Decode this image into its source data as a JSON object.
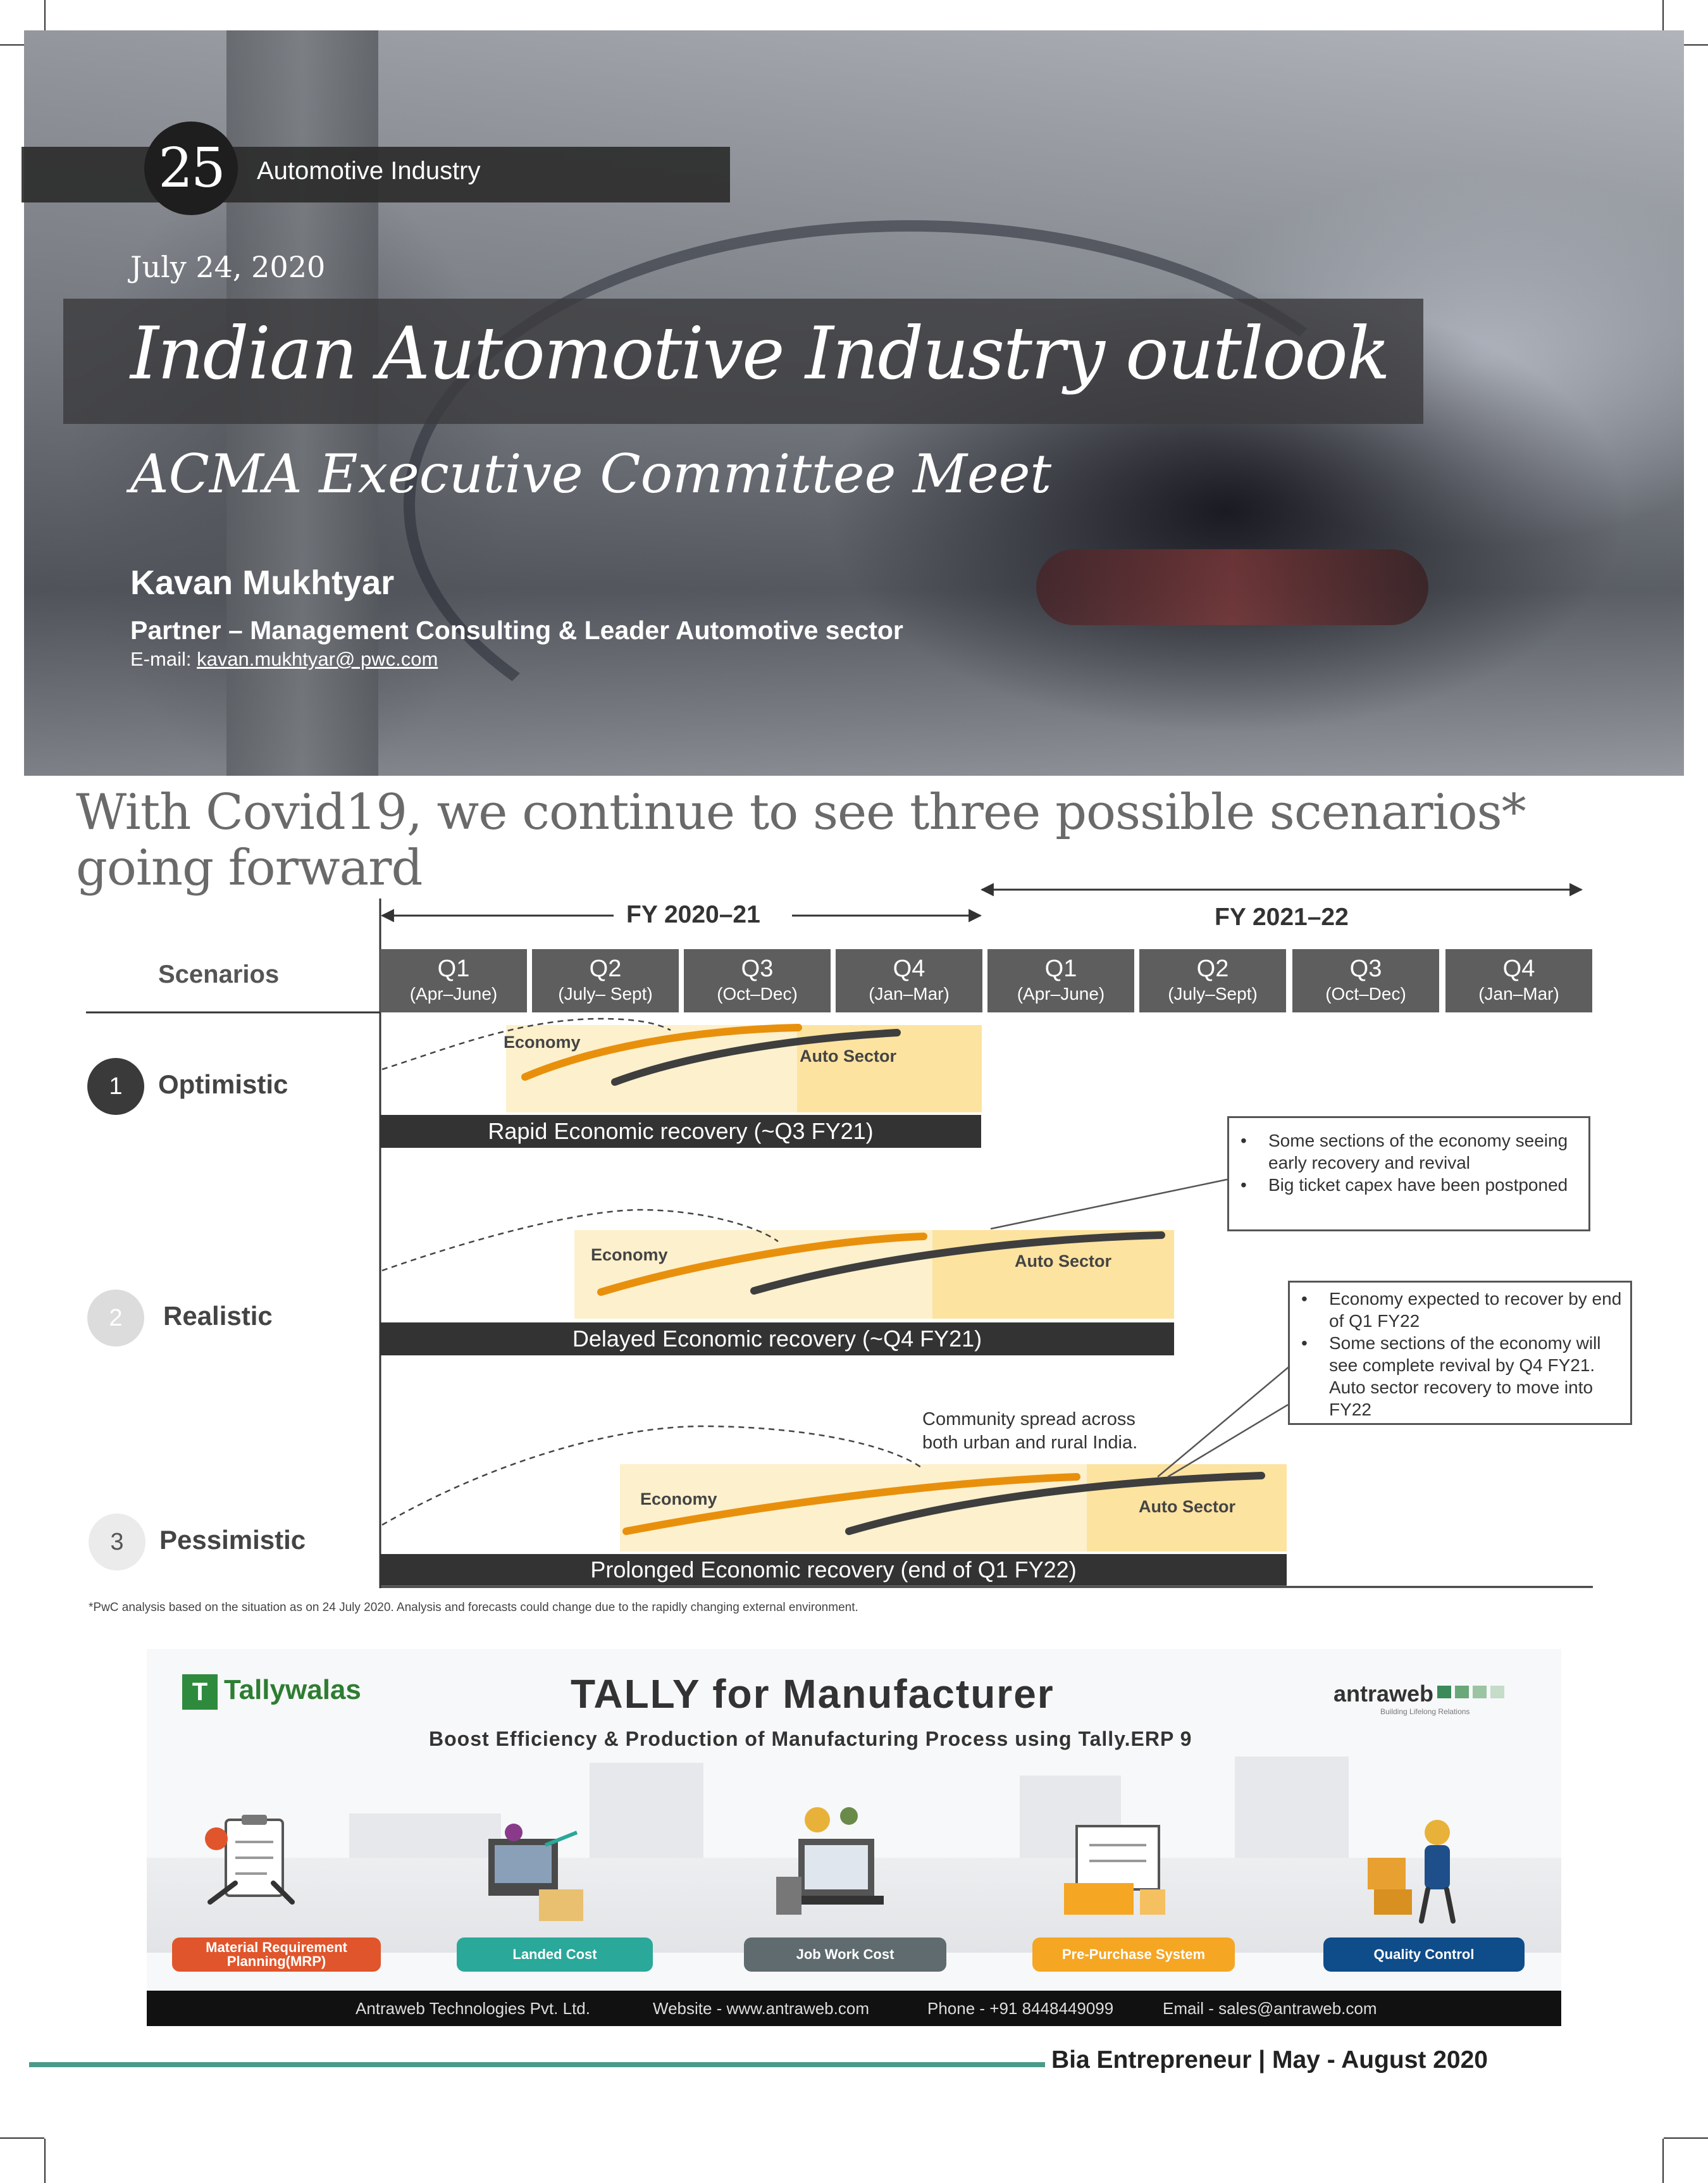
{
  "header": {
    "page_number": "25",
    "section": "Automotive Industry",
    "date": "July 24, 2020",
    "title": "Indian Automotive Industry outlook",
    "subtitle": "ACMA Executive Committee Meet",
    "author": "Kavan Mukhtyar",
    "role": "Partner – Management Consulting & Leader Automotive  sector",
    "email_label": "E-mail: ",
    "email": "kavan.mukhtyar@  pwc.com"
  },
  "chart": {
    "heading": "With Covid19, we continue to see three possible scenarios* going forward",
    "fy1": "FY 2020–21",
    "fy2": "FY 2021–22",
    "scenarios_header": "Scenarios",
    "quarters": [
      {
        "q": "Q1",
        "p": "(Apr–June)"
      },
      {
        "q": "Q2",
        "p": "(July– Sept)"
      },
      {
        "q": "Q3",
        "p": "(Oct–Dec)"
      },
      {
        "q": "Q4",
        "p": "(Jan–Mar)"
      },
      {
        "q": "Q1",
        "p": "(Apr–June)"
      },
      {
        "q": "Q2",
        "p": "(July–Sept)"
      },
      {
        "q": "Q3",
        "p": "(Oct–Dec)"
      },
      {
        "q": "Q4",
        "p": "(Jan–Mar)"
      }
    ],
    "scenarios": [
      {
        "num": "1",
        "name": "Optimistic",
        "bar": "Rapid Economic recovery  (~Q3 FY21)",
        "economy": "Economy",
        "auto": "Auto Sector"
      },
      {
        "num": "2",
        "name": "Realistic",
        "bar": "Delayed Economic recovery  (~Q4 FY21)",
        "economy": "Economy",
        "auto": "Auto Sector"
      },
      {
        "num": "3",
        "name": "Pessimistic",
        "bar": "Prolonged Economic recovery (end of Q1 FY22)",
        "economy": "Economy",
        "auto": "Auto Sector"
      }
    ],
    "callout1": [
      "Some sections of the economy seeing early recovery and revival",
      "Big ticket capex have been postponed"
    ],
    "callout2": [
      "Economy expected to recover by end of Q1 FY22",
      "Some sections of the economy will see complete revival by Q4 FY21. Auto sector recovery to move into FY22"
    ],
    "community_line1": "Community spread across",
    "community_line2": "both urban and rural India.",
    "footnote": "*PwC analysis based on the situation as on 24 July 2020. Analysis and forecasts could change due to the rapidly changing external environment."
  },
  "ad": {
    "logo": "Tallywalas",
    "logo_mark": "T",
    "title": "TALLY for Manufacturer",
    "tagline": "Boost Efficiency & Production of Manufacturing Process using Tally.ERP 9",
    "brand": "antraweb",
    "brand_sub": "Building Lifelong Relations",
    "pills": [
      {
        "line1": "Material Requirement",
        "line2": "Planning(MRP)",
        "color": "#e0552b"
      },
      {
        "line1": "Landed Cost",
        "line2": "",
        "color": "#2aa89a"
      },
      {
        "line1": "Job Work Cost",
        "line2": "",
        "color": "#5f6b6e"
      },
      {
        "line1": "Pre-Purchase System",
        "line2": "",
        "color": "#f5a623"
      },
      {
        "line1": "Quality Control",
        "line2": "",
        "color": "#0f4c8a"
      }
    ],
    "footer": {
      "company": "Antraweb Technologies Pvt. Ltd.",
      "website": "Website - www.antraweb.com",
      "phone": "Phone -  +91 8448449099",
      "email": "Email - sales@antraweb.com"
    }
  },
  "footer": {
    "magazine": "Bia Entrepreneur | May - August 2020"
  },
  "colors": {
    "economy_curve": "#e8900c",
    "auto_curve": "#3e3e3e",
    "zone_light": "#fdf0cc",
    "zone_dark": "#fde3a0",
    "footer_line": "#4a9a8a"
  }
}
